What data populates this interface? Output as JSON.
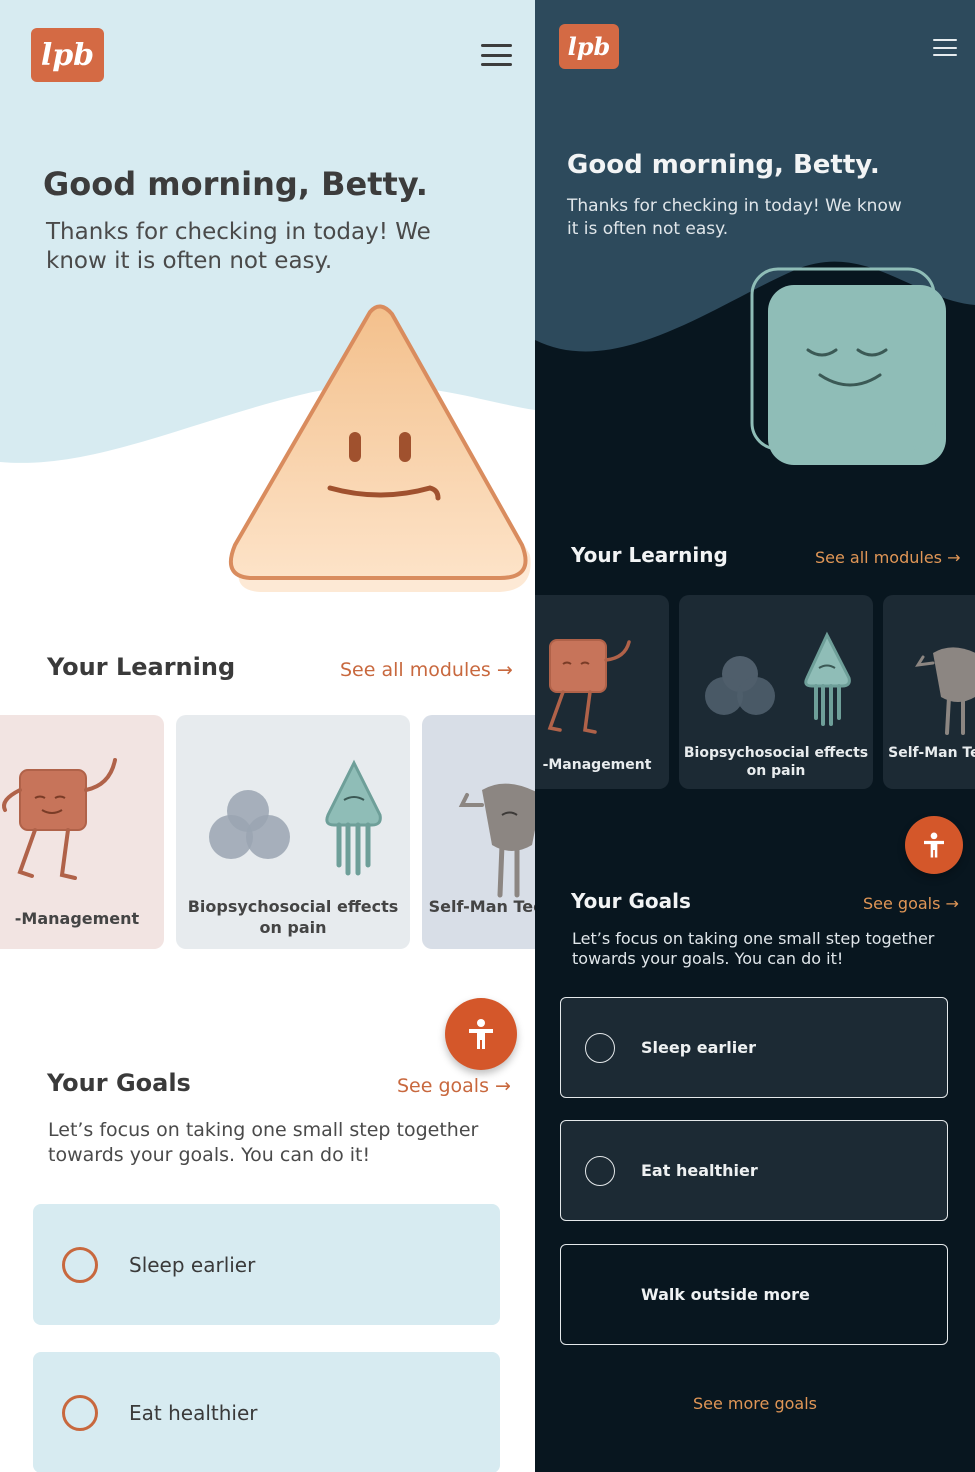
{
  "brand": {
    "logo_text": "lpb",
    "accent": "#d46a44"
  },
  "light": {
    "greeting": "Good morning, Betty.",
    "subtitle": "Thanks for checking in today! We know it is often not easy.",
    "learning": {
      "title": "Your Learning",
      "link": "See all modules →",
      "cards": [
        {
          "label": "-Management",
          "bg": "#f2e4e2"
        },
        {
          "label": "Biopsychosocial effects on pain",
          "bg": "#e7ebee"
        },
        {
          "label": "Self-Man Techn",
          "bg": "#d8dee7"
        }
      ]
    },
    "goals": {
      "title": "Your Goals",
      "link": "See goals →",
      "description": "Let’s focus on taking one small step together towards your goals. You can do it!",
      "items": [
        "Sleep earlier",
        "Eat healthier"
      ]
    },
    "colors": {
      "hero": "#d7ebf1",
      "text": "#3c3c3c",
      "link": "#c8683e"
    }
  },
  "dark": {
    "greeting": "Good morning, Betty.",
    "subtitle": "Thanks for checking in today! We know it is often not easy.",
    "learning": {
      "title": "Your Learning",
      "link": "See all modules →",
      "cards": [
        {
          "label": "-Management"
        },
        {
          "label": "Biopsychosocial effects on pain"
        },
        {
          "label": "Self-Man Techn"
        }
      ]
    },
    "goals": {
      "title": "Your Goals",
      "link": "See goals →",
      "description": "Let’s focus on taking one small step together towards your goals. You can do it!",
      "items": [
        "Sleep earlier",
        "Eat healthier",
        "Walk outside more"
      ]
    },
    "more_goals": "See more goals",
    "colors": {
      "hero": "#2d4a5c",
      "bg": "#08161f",
      "card": "#1c2a34",
      "link": "#e09656"
    }
  },
  "icons": [
    "hamburger-menu-icon",
    "accessibility-icon",
    "radio-icon"
  ]
}
